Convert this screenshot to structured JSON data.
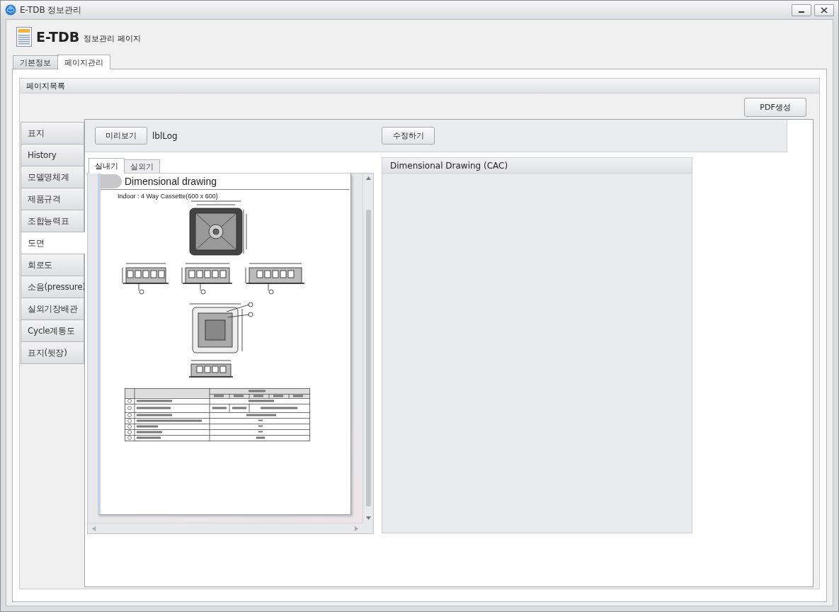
{
  "window": {
    "title": "E-TDB 정보관리"
  },
  "header": {
    "title": "E-TDB",
    "subtitle": "정보관리 페이지"
  },
  "tabs": [
    {
      "label": "기본정보",
      "selected": false
    },
    {
      "label": "페이지관리",
      "selected": true
    }
  ],
  "page_list": {
    "title": "페이지목록",
    "pdf_button": "PDF생성",
    "pages": [
      {
        "label": "표지",
        "selected": false
      },
      {
        "label": "History",
        "selected": false
      },
      {
        "label": "모델명체계",
        "selected": false
      },
      {
        "label": "제품규격",
        "selected": false
      },
      {
        "label": "조합능력표",
        "selected": false
      },
      {
        "label": "도면",
        "selected": true
      },
      {
        "label": "회로도",
        "selected": false
      },
      {
        "label": "소음(pressure)",
        "selected": false
      },
      {
        "label": "실외기장배관",
        "selected": false
      },
      {
        "label": "Cycle계통도",
        "selected": false
      },
      {
        "label": "표지(뒷장)",
        "selected": false
      }
    ]
  },
  "toolbar": {
    "preview_button": "미리보기",
    "log_label": "lblLog",
    "edit_button": "수정하기"
  },
  "unit_tabs": [
    {
      "label": "실내기",
      "selected": true
    },
    {
      "label": "실외기",
      "selected": false
    }
  ],
  "document": {
    "heading": "Dimensional drawing",
    "subtitle": "Indoor : 4 Way Cassette(600 x 600)"
  },
  "detail_panel": {
    "title": "Dimensional Drawing (CAC)"
  }
}
